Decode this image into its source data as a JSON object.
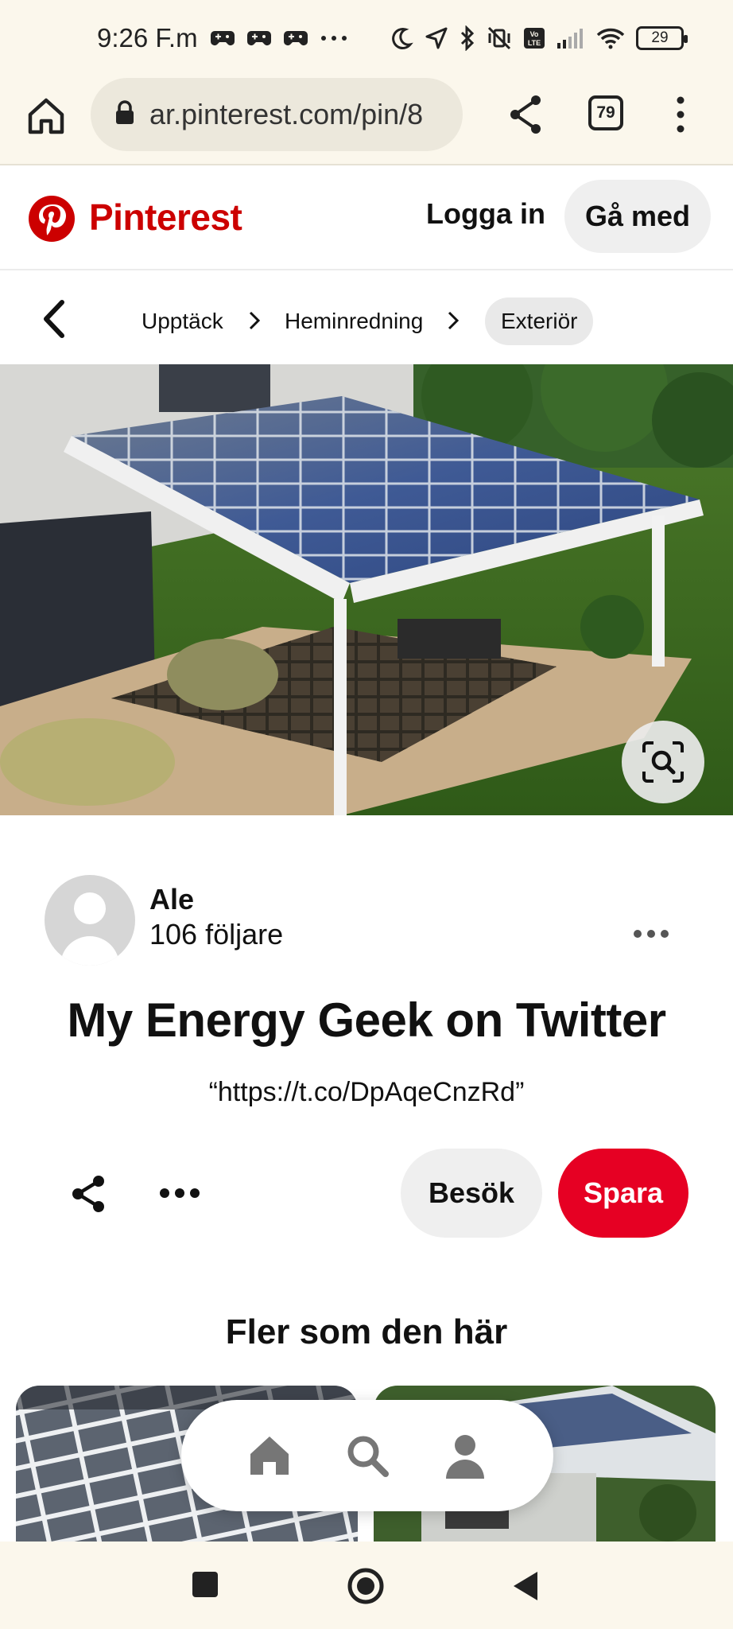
{
  "status_bar": {
    "time": "9:26 F.m",
    "battery": "29"
  },
  "browser": {
    "url": "ar.pinterest.com/pin/8",
    "tab_count": "79"
  },
  "header": {
    "brand": "Pinterest",
    "login_label": "Logga in",
    "join_label": "Gå med",
    "brand_color": "#cc0000"
  },
  "breadcrumb": {
    "items": [
      "Upptäck",
      "Heminredning",
      "Exteriör"
    ]
  },
  "pin": {
    "author_name": "Ale",
    "followers": "106 följare",
    "title": "My Energy Geek on Twitter",
    "description": "“https://t.co/DpAqeCnzRd”",
    "visit_label": "Besök",
    "save_label": "Spara",
    "save_color": "#e60023"
  },
  "related": {
    "heading": "Fler som den här"
  },
  "icons": {
    "status_left": [
      "game-controller-icon",
      "game-controller-icon",
      "game-controller-icon",
      "ellipsis-icon"
    ],
    "status_right": [
      "moon-icon",
      "location-arrow-icon",
      "bluetooth-icon",
      "vibrate-off-icon",
      "volte-icon",
      "signal-icon",
      "wifi-icon",
      "battery-icon"
    ],
    "browser": [
      "home-icon",
      "lock-icon",
      "share-icon",
      "tabs-icon",
      "kebab-menu-icon"
    ],
    "floating_nav": [
      "home-icon",
      "search-icon",
      "profile-icon"
    ],
    "system_nav": [
      "recents-square-icon",
      "home-circle-icon",
      "back-triangle-icon"
    ]
  }
}
